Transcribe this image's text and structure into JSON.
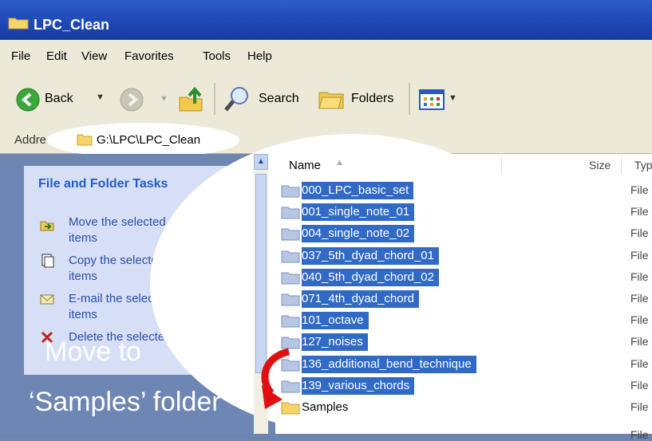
{
  "window": {
    "title": "LPC_Clean"
  },
  "menu": [
    "File",
    "Edit",
    "View",
    "Favorites",
    "Tools",
    "Help"
  ],
  "toolbar": {
    "back": "Back",
    "search": "Search",
    "folders": "Folders"
  },
  "address": {
    "label": "Address",
    "path": "G:\\LPC\\LPC_Clean"
  },
  "tasks": {
    "header": "File and Folder Tasks",
    "items": [
      {
        "line1": "Move the selected",
        "line2": "items",
        "icon": "move-icon"
      },
      {
        "line1": "Copy the selected",
        "line2": "items",
        "icon": "copy-icon"
      },
      {
        "line1": "E-mail the selected",
        "line2": "items",
        "icon": "email-icon"
      },
      {
        "line1": "Delete the selected",
        "line2": "",
        "icon": "delete-icon"
      }
    ]
  },
  "overlay": {
    "line1": "Move to",
    "line2": "‘Samples’ folder"
  },
  "columns": {
    "name": "Name",
    "size": "Size",
    "type": "Typ"
  },
  "files": [
    {
      "name": "000_LPC_basic_set",
      "type": "File",
      "selected": true
    },
    {
      "name": "001_single_note_01",
      "type": "File",
      "selected": true
    },
    {
      "name": "004_single_note_02",
      "type": "File",
      "selected": true
    },
    {
      "name": "037_5th_dyad_chord_01",
      "type": "File",
      "selected": true
    },
    {
      "name": "040_5th_dyad_chord_02",
      "type": "File",
      "selected": true
    },
    {
      "name": "071_4th_dyad_chord",
      "type": "File",
      "selected": true
    },
    {
      "name": "101_octave",
      "type": "File",
      "selected": true
    },
    {
      "name": "127_noises",
      "type": "File",
      "selected": true
    },
    {
      "name": "136_additional_bend_technique",
      "type": "File",
      "selected": true
    },
    {
      "name": "139_various_chords",
      "type": "File",
      "selected": true
    },
    {
      "name": "Samples",
      "type": "File",
      "selected": false
    }
  ],
  "extra_type_labels": [
    "File"
  ],
  "colors": {
    "selection": "#316ac5",
    "titlebar": "#1f4ab8",
    "arrow": "#e01010"
  }
}
